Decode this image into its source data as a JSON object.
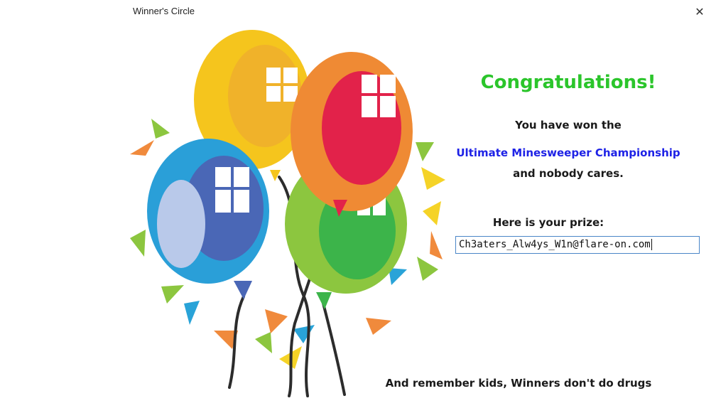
{
  "window": {
    "title": "Winner's Circle",
    "close_glyph": "✕"
  },
  "content": {
    "heading": "Congratulations!",
    "line1": "You have won the",
    "line2": "Ultimate Minesweeper Championship",
    "line3": "and nobody cares.",
    "prize_label": "Here is your prize:",
    "prize_value": "Ch3aters_Alw4ys_W1n@flare-on.com",
    "footer": "And remember kids, Winners don't do drugs"
  },
  "colors": {
    "heading": "#2bc52b",
    "highlight": "#1e22e6",
    "text": "#1a1a1a"
  },
  "illustration": {
    "icon": "balloons-illustration"
  }
}
